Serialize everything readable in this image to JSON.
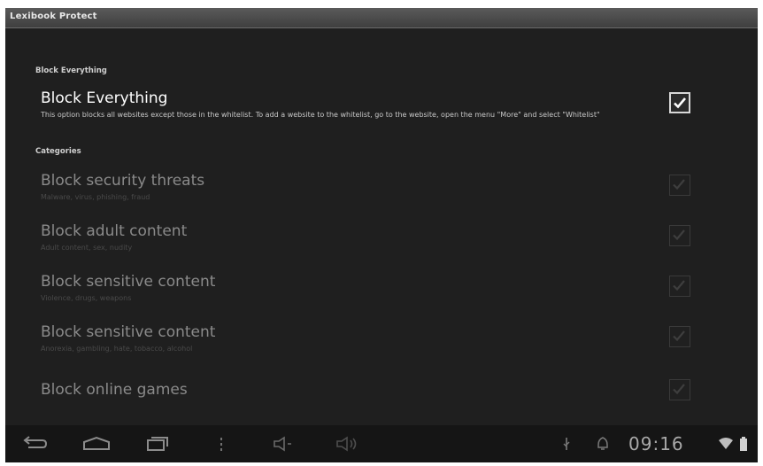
{
  "app": {
    "title": "Lexibook Protect"
  },
  "sections": {
    "block_everything": {
      "header": "Block Everything",
      "item": {
        "title": "Block Everything",
        "summary": "This option blocks all websites except those in the whitelist. To add a website to the whitelist, go to the website, open the menu \"More\" and select \"Whitelist\"",
        "checked": true
      }
    },
    "categories": {
      "header": "Categories",
      "items": [
        {
          "title": "Block security threats",
          "summary": "Malware, virus, phishing, fraud",
          "checked": true,
          "enabled": false
        },
        {
          "title": "Block adult content",
          "summary": "Adult content, sex, nudity",
          "checked": true,
          "enabled": false
        },
        {
          "title": "Block sensitive content",
          "summary": "Violence, drugs, weapons",
          "checked": true,
          "enabled": false
        },
        {
          "title": "Block sensitive content",
          "summary": "Anorexia, gambling, hate, tobacco, alcohol",
          "checked": true,
          "enabled": false
        },
        {
          "title": "Block online games",
          "summary": "",
          "checked": true,
          "enabled": false
        }
      ]
    }
  },
  "status_bar": {
    "time": "09:16"
  },
  "icons": {
    "nav": [
      "back-icon",
      "home-icon",
      "recent-apps-icon",
      "menu-icon",
      "volume-down-icon",
      "volume-up-icon"
    ],
    "status": [
      "usb-icon",
      "notification-icon",
      "wifi-icon",
      "battery-icon"
    ]
  }
}
